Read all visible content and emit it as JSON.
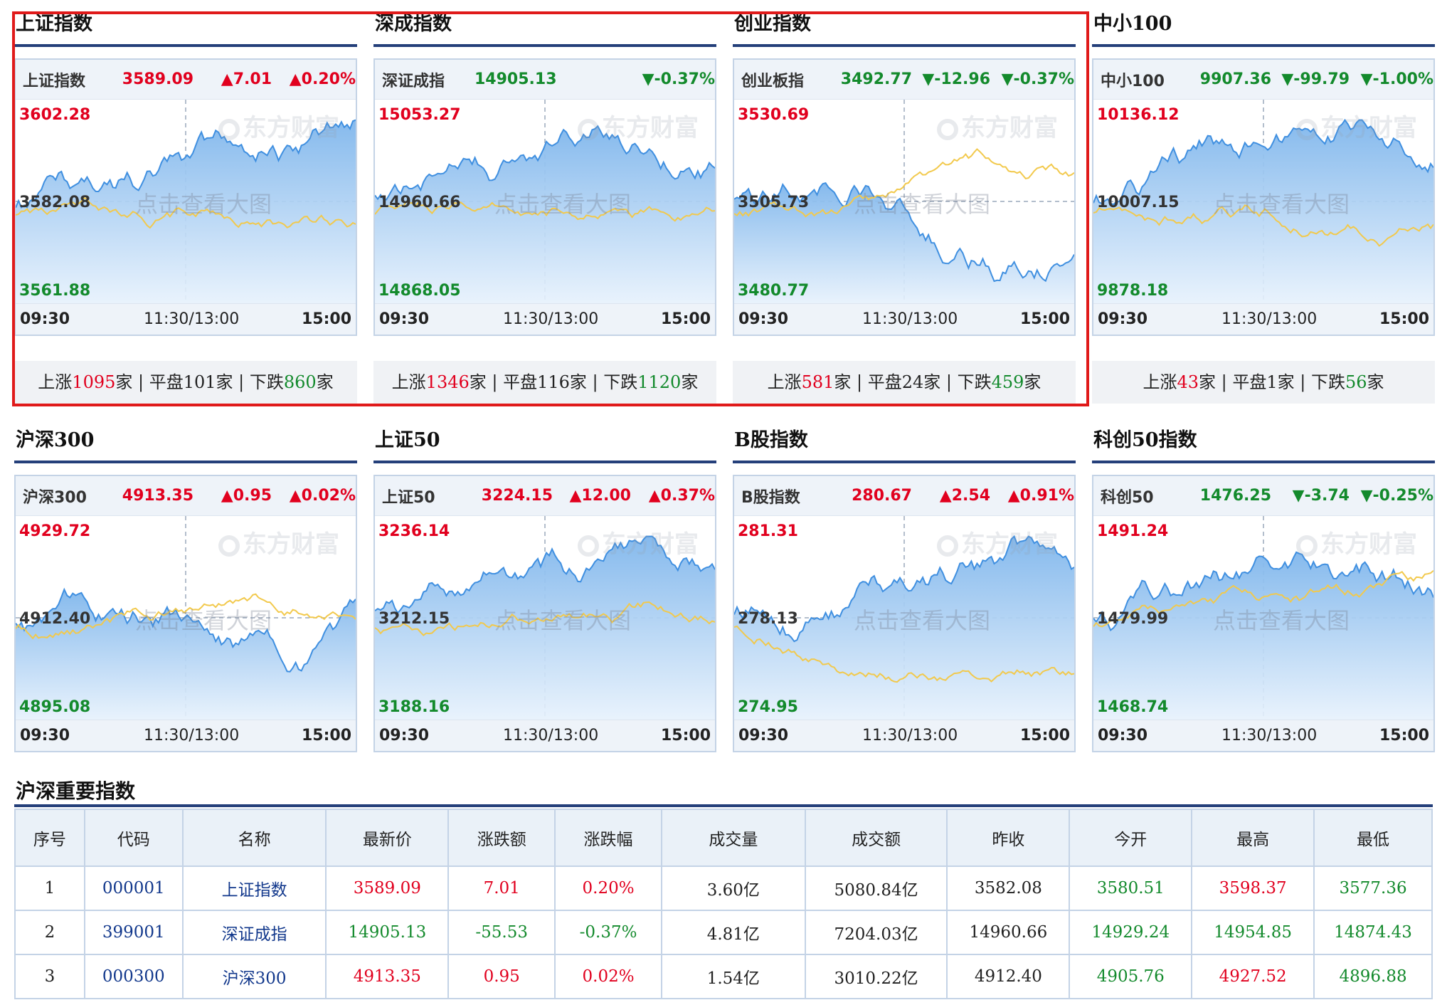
{
  "panels": [
    {
      "title": "上证指数",
      "name": "上证指数",
      "price": "3589.09",
      "change": "▲7.01",
      "pct": "▲0.20%",
      "dir": "up",
      "hi": "3602.28",
      "mid": "3582.08",
      "lo": "3561.88",
      "t0": "09:30",
      "t1": "11:30/13:00",
      "t2": "15:00",
      "up_label": "上涨",
      "up": "1095",
      "flat_label": "平盘",
      "flat": "101",
      "down_label": "下跌",
      "down": "860",
      "unit": "家"
    },
    {
      "title": "深成指数",
      "name": "深证成指",
      "price": "14905.13",
      "change": "",
      "pct": "▼-0.37%",
      "dir": "down",
      "hi": "15053.27",
      "mid": "14960.66",
      "lo": "14868.05",
      "t0": "09:30",
      "t1": "11:30/13:00",
      "t2": "15:00",
      "up_label": "上涨",
      "up": "1346",
      "flat_label": "平盘",
      "flat": "116",
      "down_label": "下跌",
      "down": "1120",
      "unit": "家"
    },
    {
      "title": "创业指数",
      "name": "创业板指",
      "price": "3492.77",
      "change": "▼-12.96",
      "pct": "▼-0.37%",
      "dir": "down",
      "hi": "3530.69",
      "mid": "3505.73",
      "lo": "3480.77",
      "t0": "09:30",
      "t1": "11:30/13:00",
      "t2": "15:00",
      "up_label": "上涨",
      "up": "581",
      "flat_label": "平盘",
      "flat": "24",
      "down_label": "下跌",
      "down": "459",
      "unit": "家"
    },
    {
      "title": "中小100",
      "name": "中小100",
      "price": "9907.36",
      "change": "▼-99.79",
      "pct": "▼-1.00%",
      "dir": "down",
      "hi": "10136.12",
      "mid": "10007.15",
      "lo": "9878.18",
      "t0": "09:30",
      "t1": "11:30/13:00",
      "t2": "15:00",
      "up_label": "上涨",
      "up": "43",
      "flat_label": "平盘",
      "flat": "1",
      "down_label": "下跌",
      "down": "56",
      "unit": "家"
    },
    {
      "title": "沪深300",
      "name": "沪深300",
      "price": "4913.35",
      "change": "▲0.95",
      "pct": "▲0.02%",
      "dir": "up",
      "hi": "4929.72",
      "mid": "4912.40",
      "lo": "4895.08",
      "t0": "09:30",
      "t1": "11:30/13:00",
      "t2": "15:00"
    },
    {
      "title": "上证50",
      "name": "上证50",
      "price": "3224.15",
      "change": "▲12.00",
      "pct": "▲0.37%",
      "dir": "up",
      "hi": "3236.14",
      "mid": "3212.15",
      "lo": "3188.16",
      "t0": "09:30",
      "t1": "11:30/13:00",
      "t2": "15:00"
    },
    {
      "title": "B股指数",
      "name": "B股指数",
      "price": "280.67",
      "change": "▲2.54",
      "pct": "▲0.91%",
      "dir": "up",
      "hi": "281.31",
      "mid": "278.13",
      "lo": "274.95",
      "t0": "09:30",
      "t1": "11:30/13:00",
      "t2": "15:00"
    },
    {
      "title": "科创50指数",
      "name": "科创50",
      "price": "1476.25",
      "change": "▼-3.74",
      "pct": "▼-0.25%",
      "dir": "down",
      "hi": "1491.24",
      "mid": "1479.99",
      "lo": "1468.74",
      "t0": "09:30",
      "t1": "11:30/13:00",
      "t2": "15:00"
    }
  ],
  "watermark": "东方财富",
  "cta": "点击查看大图",
  "table": {
    "title": "沪深重要指数",
    "headers": [
      "序号",
      "代码",
      "名称",
      "最新价",
      "涨跌额",
      "涨跌幅",
      "成交量",
      "成交额",
      "昨收",
      "今开",
      "最高",
      "最低"
    ],
    "rows": [
      [
        "1",
        "000001",
        "上证指数",
        "3589.09",
        "7.01",
        "0.20%",
        "3.60亿",
        "5080.84亿",
        "3582.08",
        "3580.51",
        "3598.37",
        "3577.36"
      ],
      [
        "2",
        "399001",
        "深证成指",
        "14905.13",
        "-55.53",
        "-0.37%",
        "4.81亿",
        "7204.03亿",
        "14960.66",
        "14929.24",
        "14954.85",
        "14874.43"
      ],
      [
        "3",
        "000300",
        "沪深300",
        "4913.35",
        "0.95",
        "0.02%",
        "1.54亿",
        "3010.22亿",
        "4912.40",
        "4905.76",
        "4927.52",
        "4896.88"
      ]
    ],
    "row_colors": [
      [
        "",
        "",
        "",
        "red",
        "red",
        "red",
        "",
        "",
        "",
        "green",
        "red",
        "green"
      ],
      [
        "",
        "",
        "",
        "green",
        "green",
        "green",
        "",
        "",
        "",
        "green",
        "green",
        "green"
      ],
      [
        "",
        "",
        "",
        "red",
        "red",
        "red",
        "",
        "",
        "",
        "green",
        "red",
        "green"
      ]
    ]
  },
  "colors": {
    "up": "#e1001e",
    "down": "#138a2c",
    "accent": "#243f7a",
    "highlight": "#e01a1a"
  }
}
